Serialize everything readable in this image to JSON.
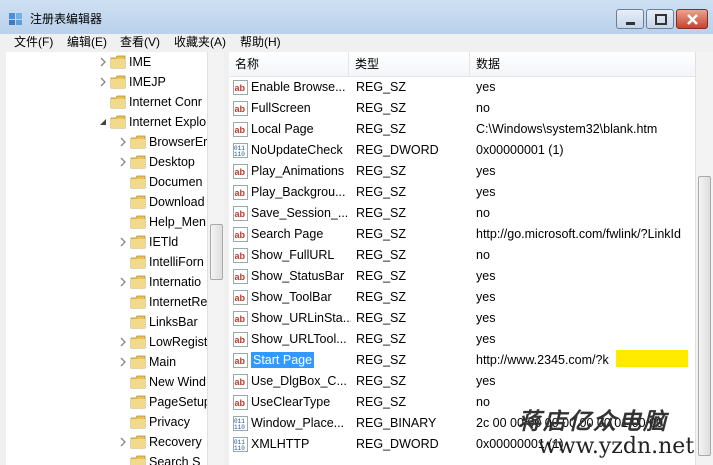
{
  "window": {
    "title": "注册表编辑器"
  },
  "menu": [
    "文件(F)",
    "编辑(E)",
    "查看(V)",
    "收藏夹(A)",
    "帮助(H)"
  ],
  "tree": [
    {
      "label": "IME",
      "expandable": true
    },
    {
      "label": "IMEJP",
      "expandable": true
    },
    {
      "label": "Internet Conr",
      "expandable": false
    },
    {
      "label": "Internet Explo",
      "expandable": true,
      "expanded": true
    },
    {
      "label": "BrowserEr",
      "expandable": true
    },
    {
      "label": "Desktop",
      "expandable": true
    },
    {
      "label": "Documen",
      "expandable": false
    },
    {
      "label": "Download",
      "expandable": false
    },
    {
      "label": "Help_Men",
      "expandable": false
    },
    {
      "label": "IETld",
      "expandable": true
    },
    {
      "label": "IntelliForn",
      "expandable": false
    },
    {
      "label": "Internatio",
      "expandable": true
    },
    {
      "label": "InternetRe",
      "expandable": false
    },
    {
      "label": "LinksBar",
      "expandable": false
    },
    {
      "label": "LowRegist",
      "expandable": true
    },
    {
      "label": "Main",
      "expandable": true,
      "selected": true
    },
    {
      "label": "New Wind",
      "expandable": false
    },
    {
      "label": "PageSetup",
      "expandable": false
    },
    {
      "label": "Privacy",
      "expandable": false
    },
    {
      "label": "Recovery",
      "expandable": true
    },
    {
      "label": "Search S",
      "expandable": false
    }
  ],
  "columns": {
    "name": "名称",
    "type": "类型",
    "data": "数据"
  },
  "values": [
    {
      "icon": "string-value-icon",
      "name": "Enable Browse...",
      "type": "REG_SZ",
      "data": "yes"
    },
    {
      "icon": "string-value-icon",
      "name": "FullScreen",
      "type": "REG_SZ",
      "data": "no"
    },
    {
      "icon": "string-value-icon",
      "name": "Local Page",
      "type": "REG_SZ",
      "data": "C:\\Windows\\system32\\blank.htm"
    },
    {
      "icon": "binary-value-icon",
      "name": "NoUpdateCheck",
      "type": "REG_DWORD",
      "data": "0x00000001 (1)"
    },
    {
      "icon": "string-value-icon",
      "name": "Play_Animations",
      "type": "REG_SZ",
      "data": "yes"
    },
    {
      "icon": "string-value-icon",
      "name": "Play_Backgrou...",
      "type": "REG_SZ",
      "data": "yes"
    },
    {
      "icon": "string-value-icon",
      "name": "Save_Session_...",
      "type": "REG_SZ",
      "data": "no"
    },
    {
      "icon": "string-value-icon",
      "name": "Search Page",
      "type": "REG_SZ",
      "data": "http://go.microsoft.com/fwlink/?LinkId"
    },
    {
      "icon": "string-value-icon",
      "name": "Show_FullURL",
      "type": "REG_SZ",
      "data": "no"
    },
    {
      "icon": "string-value-icon",
      "name": "Show_StatusBar",
      "type": "REG_SZ",
      "data": "yes"
    },
    {
      "icon": "string-value-icon",
      "name": "Show_ToolBar",
      "type": "REG_SZ",
      "data": "yes"
    },
    {
      "icon": "string-value-icon",
      "name": "Show_URLinSta...",
      "type": "REG_SZ",
      "data": "yes"
    },
    {
      "icon": "string-value-icon",
      "name": "Show_URLTool...",
      "type": "REG_SZ",
      "data": "yes"
    },
    {
      "icon": "string-value-icon",
      "name": "Start Page",
      "type": "REG_SZ",
      "data": "http://www.2345.com/?k",
      "selected": true
    },
    {
      "icon": "string-value-icon",
      "name": "Use_DlgBox_C...",
      "type": "REG_SZ",
      "data": "yes"
    },
    {
      "icon": "string-value-icon",
      "name": "UseClearType",
      "type": "REG_SZ",
      "data": "no"
    },
    {
      "icon": "binary-value-icon",
      "name": "Window_Place...",
      "type": "REG_BINARY",
      "data": "2c 00 00 00 00 00 00 00 01 00 00"
    },
    {
      "icon": "binary-value-icon",
      "name": "XMLHTTP",
      "type": "REG_DWORD",
      "data": "0x00000001 (1)"
    }
  ],
  "watermark": {
    "text_cn": "蒋店亿众电脑",
    "text_url": "www.yzdn.net"
  },
  "colors": {
    "selection": "#3399ff",
    "highlight": "#ffea00",
    "folder": "#e8c15a"
  }
}
